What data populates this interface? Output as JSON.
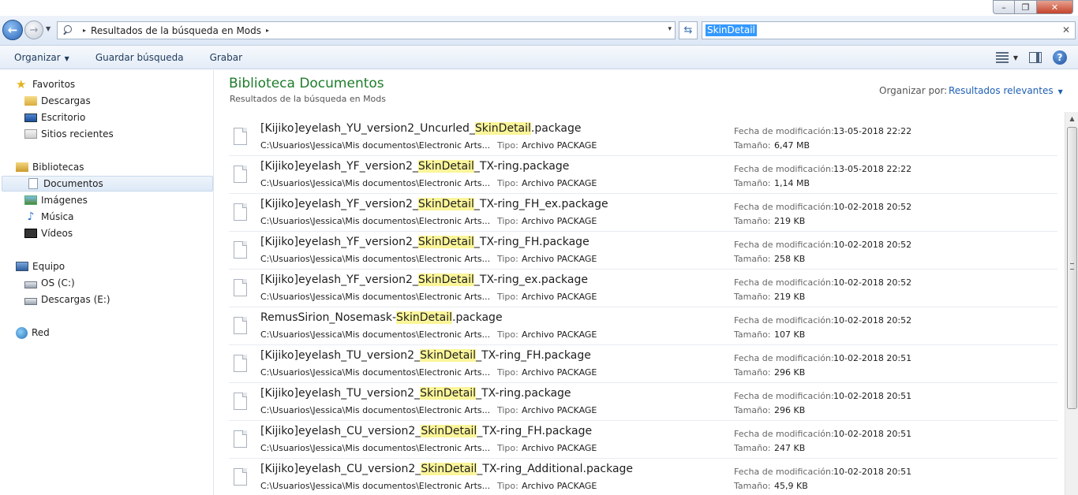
{
  "window": {
    "controls": {
      "minimize": "–",
      "maximize": "❐",
      "close": "✕"
    }
  },
  "address_bar": {
    "location": "Resultados de la búsqueda en Mods",
    "separator": "▸",
    "dropdown": "▾"
  },
  "search": {
    "value": "SkinDetail",
    "clear": "✕"
  },
  "toolbar": {
    "organize": "Organizar",
    "save_search": "Guardar búsqueda",
    "burn": "Grabar"
  },
  "sidebar": {
    "favorites": {
      "label": "Favoritos",
      "items": [
        "Descargas",
        "Escritorio",
        "Sitios recientes"
      ]
    },
    "libraries": {
      "label": "Bibliotecas",
      "items": [
        "Documentos",
        "Imágenes",
        "Música",
        "Vídeos"
      ],
      "selected": "Documentos"
    },
    "computer": {
      "label": "Equipo",
      "items": [
        "OS (C:)",
        "Descargas (E:)"
      ]
    },
    "network": {
      "label": "Red"
    }
  },
  "content": {
    "title": "Biblioteca Documentos",
    "subtitle": "Resultados de la búsqueda en Mods",
    "sort_label": "Organizar por:",
    "sort_value": "Resultados relevantes",
    "labels": {
      "type": "Tipo:",
      "modified": "Fecha de modificación:",
      "size": "Tamaño:"
    },
    "files": [
      {
        "name_pre": "[Kijiko]eyelash_YU_version2_Uncurled_",
        "highlight": "SkinDetail",
        "name_post": ".package",
        "path": "C:\\Usuarios\\Jessica\\Mis documentos\\Electronic Arts...",
        "type": "Archivo PACKAGE",
        "modified": "13-05-2018 22:22",
        "size": "6,47 MB"
      },
      {
        "name_pre": "[Kijiko]eyelash_YF_version2_",
        "highlight": "SkinDetail",
        "name_post": "_TX-ring.package",
        "path": "C:\\Usuarios\\Jessica\\Mis documentos\\Electronic Arts...",
        "type": "Archivo PACKAGE",
        "modified": "13-05-2018 22:22",
        "size": "1,14 MB"
      },
      {
        "name_pre": "[Kijiko]eyelash_YF_version2_",
        "highlight": "SkinDetail",
        "name_post": "_TX-ring_FH_ex.package",
        "path": "C:\\Usuarios\\Jessica\\Mis documentos\\Electronic Arts...",
        "type": "Archivo PACKAGE",
        "modified": "10-02-2018 20:52",
        "size": "219 KB"
      },
      {
        "name_pre": "[Kijiko]eyelash_YF_version2_",
        "highlight": "SkinDetail",
        "name_post": "_TX-ring_FH.package",
        "path": "C:\\Usuarios\\Jessica\\Mis documentos\\Electronic Arts...",
        "type": "Archivo PACKAGE",
        "modified": "10-02-2018 20:52",
        "size": "258 KB"
      },
      {
        "name_pre": "[Kijiko]eyelash_YF_version2_",
        "highlight": "SkinDetail",
        "name_post": "_TX-ring_ex.package",
        "path": "C:\\Usuarios\\Jessica\\Mis documentos\\Electronic Arts...",
        "type": "Archivo PACKAGE",
        "modified": "10-02-2018 20:52",
        "size": "219 KB"
      },
      {
        "name_pre": "RemusSirion_Nosemask-",
        "highlight": "SkinDetail",
        "name_post": ".package",
        "path": "C:\\Usuarios\\Jessica\\Mis documentos\\Electronic Arts...",
        "type": "Archivo PACKAGE",
        "modified": "10-02-2018 20:52",
        "size": "107 KB"
      },
      {
        "name_pre": "[Kijiko]eyelash_TU_version2_",
        "highlight": "SkinDetail",
        "name_post": "_TX-ring_FH.package",
        "path": "C:\\Usuarios\\Jessica\\Mis documentos\\Electronic Arts...",
        "type": "Archivo PACKAGE",
        "modified": "10-02-2018 20:51",
        "size": "296 KB"
      },
      {
        "name_pre": "[Kijiko]eyelash_TU_version2_",
        "highlight": "SkinDetail",
        "name_post": "_TX-ring.package",
        "path": "C:\\Usuarios\\Jessica\\Mis documentos\\Electronic Arts...",
        "type": "Archivo PACKAGE",
        "modified": "10-02-2018 20:51",
        "size": "296 KB"
      },
      {
        "name_pre": "[Kijiko]eyelash_CU_version2_",
        "highlight": "SkinDetail",
        "name_post": "_TX-ring_FH.package",
        "path": "C:\\Usuarios\\Jessica\\Mis documentos\\Electronic Arts...",
        "type": "Archivo PACKAGE",
        "modified": "10-02-2018 20:51",
        "size": "247 KB"
      },
      {
        "name_pre": "[Kijiko]eyelash_CU_version2_",
        "highlight": "SkinDetail",
        "name_post": "_TX-ring_Additional.package",
        "path": "C:\\Usuarios\\Jessica\\Mis documentos\\Electronic Arts...",
        "type": "Archivo PACKAGE",
        "modified": "10-02-2018 20:51",
        "size": "45,9 KB"
      }
    ]
  },
  "icons": {
    "back": "back-arrow-icon",
    "forward": "forward-arrow-icon",
    "refresh": "refresh-icon",
    "views": "views-icon",
    "preview_pane": "preview-pane-icon",
    "help": "help-icon",
    "file": "file-icon"
  },
  "colors": {
    "library_title": "#1e7d2a",
    "sort_value": "#1e5fb4",
    "highlight": "#fbf59a",
    "search_selection": "#3399ff"
  }
}
